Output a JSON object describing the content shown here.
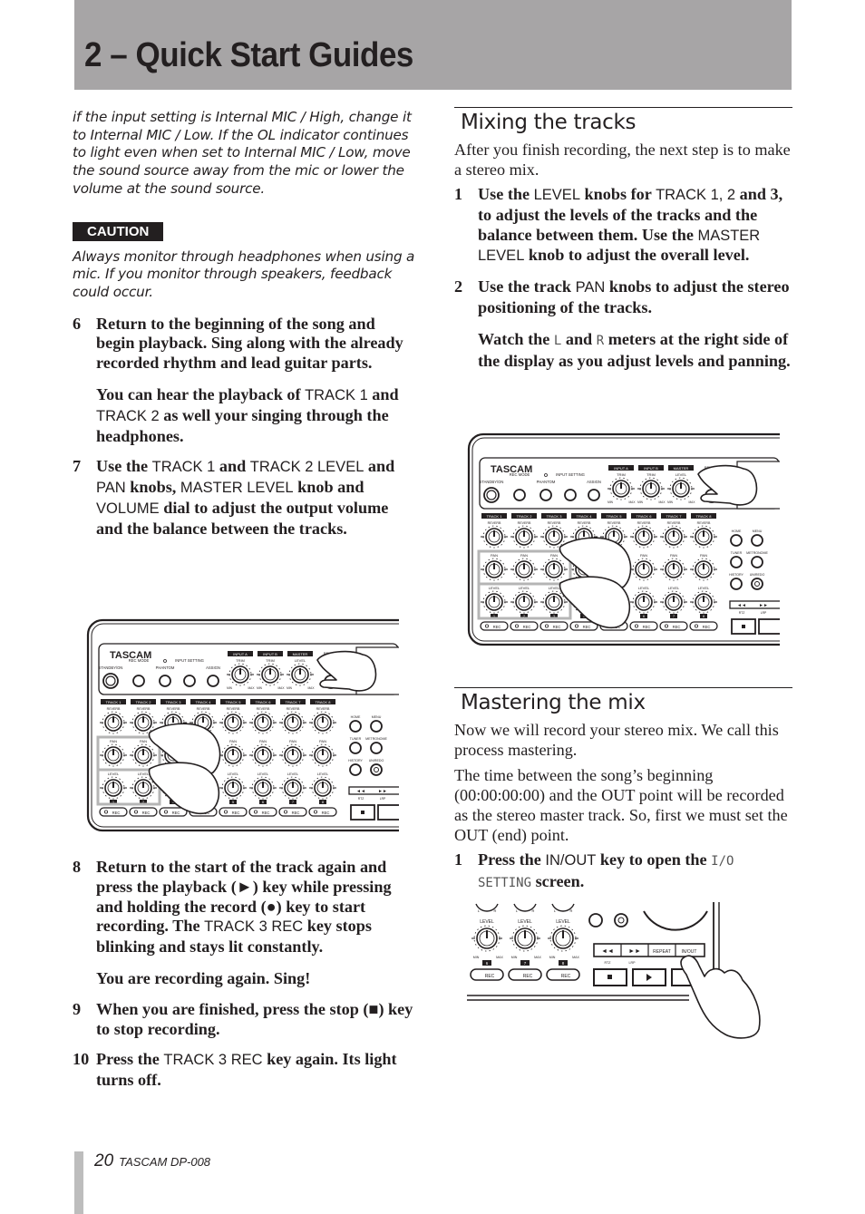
{
  "header": {
    "title": "2 – Quick Start Guides"
  },
  "left": {
    "intro_note": "if the input setting is Internal MIC / High, change it to Internal MIC / Low. If the OL indicator continues to light even when set to Internal MIC / Low, move the sound source away from the mic or lower the volume at the sound source.",
    "caution": {
      "label": "CAUTION",
      "text": "Always monitor through headphones when using a mic. If you monitor through speakers, feedback could occur."
    },
    "steps": [
      {
        "num": "6",
        "text": "Return to the beginning of the song and begin playback. Sing along with the already recorded rhythm and lead guitar parts.",
        "sub": {
          "pre": "You can hear the playback of ",
          "k1": "TRACK 1",
          "mid": " and ",
          "k2": "TRACK 2",
          "post": " as well your singing through the headphones."
        }
      },
      {
        "num": "7",
        "parts": [
          "Use the ",
          "TRACK 1",
          " and ",
          "TRACK 2 LEVEL",
          " and ",
          "PAN",
          " knobs, ",
          "MASTER LEVEL",
          " knob and ",
          "VOLUME",
          " dial to adjust the output volume and the balance between the tracks."
        ]
      },
      {
        "num": "8",
        "parts": [
          "Return to the start of the track again and press the playback (►) key while pressing and holding the record (●) key to start recording. The ",
          "TRACK 3 REC",
          " key stops blinking and stays lit constantly."
        ],
        "sub": "You are recording again. Sing!"
      },
      {
        "num": "9",
        "text": "When you are finished, press the stop (■) key to stop recording."
      },
      {
        "num": "10",
        "parts": [
          "Press the ",
          "TRACK 3 REC",
          " key again. Its light turns off."
        ]
      }
    ]
  },
  "mixing": {
    "title": "Mixing the tracks",
    "intro": "After you finish recording, the next step is to make a stereo mix.",
    "steps": [
      {
        "num": "1",
        "parts": [
          "Use the ",
          "LEVEL",
          " knobs for ",
          "TRACK 1, 2",
          " and 3, to adjust the levels of the tracks and the balance between them. Use the ",
          "MASTER LEVEL",
          " knob to adjust the overall level."
        ]
      },
      {
        "num": "2",
        "parts": [
          "Use the track ",
          "PAN",
          " knobs to adjust the stereo positioning of the tracks."
        ],
        "sub": {
          "pre": "Watch the ",
          "l": "L",
          "mid": " and ",
          "r": "R",
          "post": " meters at the right side of the display as you adjust levels and panning."
        }
      }
    ]
  },
  "mastering": {
    "title": "Mastering the mix",
    "para1": "Now we will record your stereo mix. We call this process mastering.",
    "para2": "The time between the song’s beginning (00:00:00:00) and the OUT point will be recorded as the stereo master track. So, first we must set the OUT (end) point.",
    "steps": [
      {
        "num": "1",
        "pre": "Press the ",
        "key": "IN/OUT",
        "mid": " key to open the ",
        "lcd1": "I/O",
        "lcd2": "SETTING",
        "post": " screen."
      }
    ]
  },
  "device": {
    "brand": "TASCAM",
    "top_buttons": [
      "STANDBY/ON",
      "REC MODE",
      "PHANTOM",
      "INPUT SETTING",
      "ASSIGN"
    ],
    "inputs": [
      "INPUT A",
      "INPUT B",
      "MASTER"
    ],
    "trim_label": "TRIM",
    "level_label": "LEVEL",
    "reverb_label": "REVERB",
    "tracks": [
      "TRACK 1",
      "TRACK 2",
      "TRACK 3",
      "TRACK 4",
      "TRACK 5",
      "TRACK 6",
      "TRACK 7",
      "TRACK 8"
    ],
    "pan_label": "PAN",
    "min": "MIN",
    "max": "MAX",
    "l": "L",
    "r": "R",
    "rec": "REC",
    "nav_buttons": [
      "HOME",
      "MENU",
      "TUNER",
      "METRONOME",
      "HISTORY",
      "UN/REDO"
    ],
    "transport": [
      "◄◄",
      "►►",
      "REPEAT",
      "IN/OUT"
    ],
    "rtz": "RTZ",
    "lrp": "LRP",
    "track_nums": [
      "1",
      "2",
      "3",
      "4",
      "5",
      "6",
      "7",
      "8"
    ],
    "bottom_nums": [
      "6",
      "7",
      "8"
    ]
  },
  "footer": {
    "page": "20",
    "model": "TASCAM  DP-008"
  }
}
